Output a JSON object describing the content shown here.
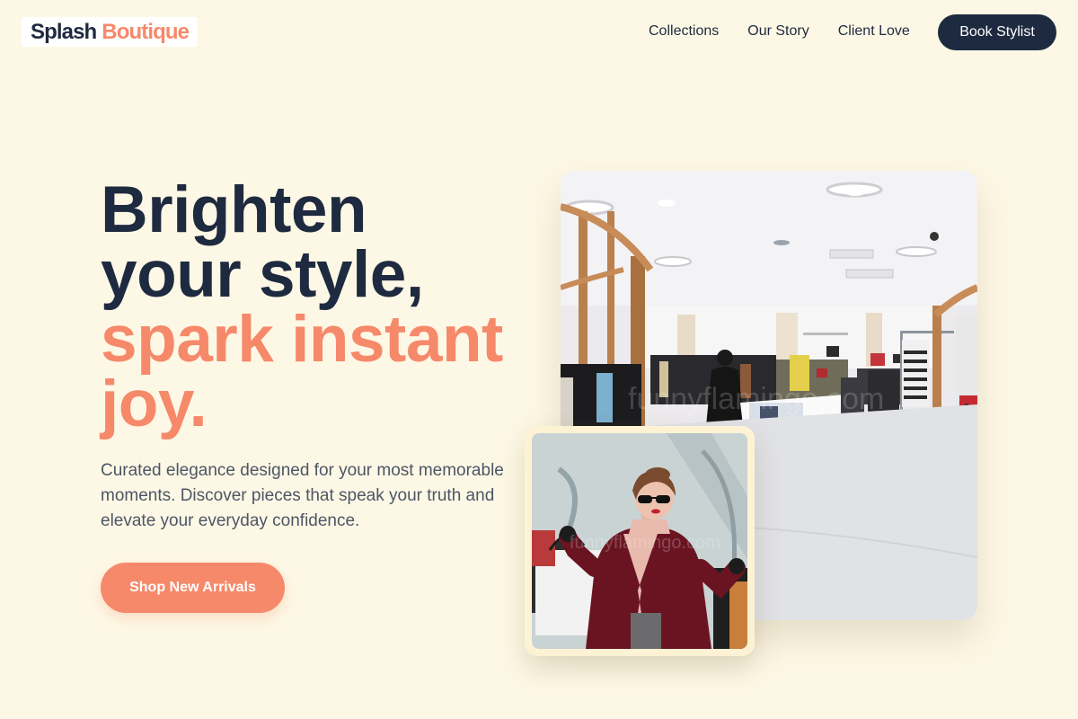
{
  "nav": {
    "logo_main": "Splash",
    "logo_accent": "Boutique",
    "links": [
      "Collections",
      "Our Story",
      "Client Love"
    ],
    "book_label": "Book Stylist"
  },
  "hero": {
    "headline_line1": "Brighten",
    "headline_line2": "your style,",
    "headline_accent1": "spark instant",
    "headline_accent2": "joy.",
    "subtext": "Curated elegance designed for your most memorable moments. Discover pieces that speak your truth and elevate your everyday confidence.",
    "cta_label": "Shop New Arrivals"
  },
  "images": {
    "store_watermark": "funnyflamingo.com",
    "woman_watermark": "funnyflamingo.com"
  },
  "colors": {
    "background": "#fdf8e5",
    "navy": "#1e2a3f",
    "accent": "#f6896a"
  }
}
